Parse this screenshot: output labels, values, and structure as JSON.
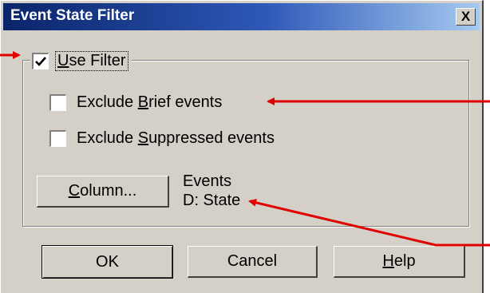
{
  "dialog": {
    "title": "Event State Filter",
    "close_glyph": "X"
  },
  "group": {
    "use_filter": {
      "pre": "",
      "accel": "U",
      "post": "se Filter",
      "checked": true
    }
  },
  "options": [
    {
      "pre": "Exclude ",
      "accel": "B",
      "post": "rief events",
      "checked": false
    },
    {
      "pre": "Exclude ",
      "accel": "S",
      "post": "uppressed events",
      "checked": false
    }
  ],
  "column_button": {
    "pre": "",
    "accel": "C",
    "post": "olumn..."
  },
  "column_info": {
    "line1": "Events",
    "line2": "D: State"
  },
  "buttons": {
    "ok": "OK",
    "cancel": "Cancel",
    "help": {
      "pre": "",
      "accel": "H",
      "post": "elp"
    }
  },
  "annotation_color": "#e00000"
}
